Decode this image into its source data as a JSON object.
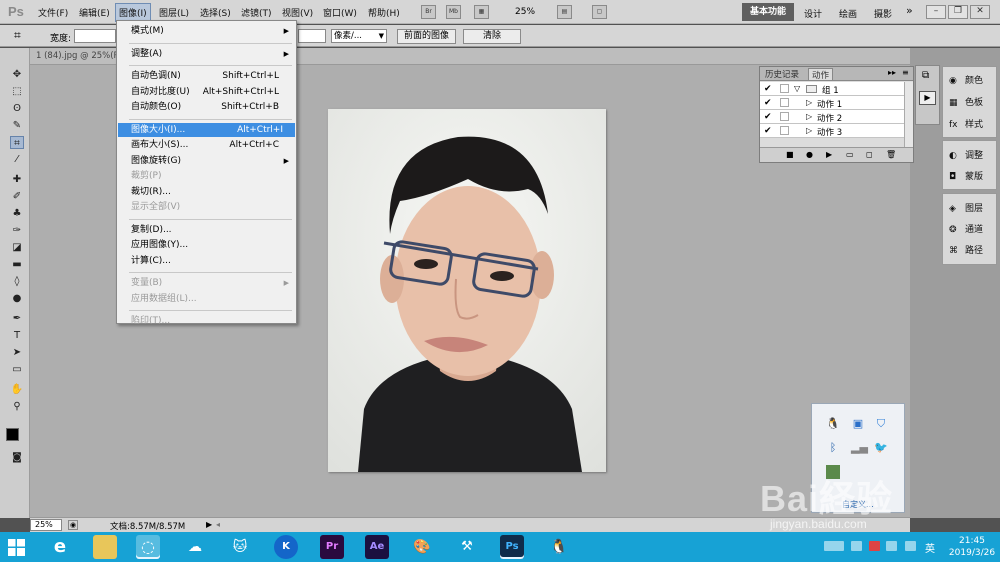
{
  "app": {
    "logo": "Ps",
    "accent": "#3d8ee2",
    "taskbar_color": "#17a2d5"
  },
  "menubar": {
    "items": [
      "文件(F)",
      "编辑(E)",
      "图像(I)",
      "图层(L)",
      "选择(S)",
      "滤镜(T)",
      "视图(V)",
      "窗口(W)",
      "帮助(H)"
    ],
    "active": "图像(I)",
    "bridge": "Br",
    "mini": "Mb",
    "zoom": "25%",
    "workspace_active": "基本功能",
    "workspaces": [
      "设计",
      "绘画",
      "摄影"
    ],
    "more": "»"
  },
  "options": {
    "width_label": "宽度:",
    "unit": "像素/...",
    "front_image": "前面的图像",
    "clear": "清除"
  },
  "document": {
    "tab_title": "1 (84).jpg @ 25%(RGB/8)"
  },
  "status": {
    "zoom": "25%",
    "doc": "文档:8.57M/8.57M"
  },
  "image_menu": [
    {
      "label": "模式(M)",
      "submenu": true
    },
    {
      "sep": true
    },
    {
      "label": "调整(A)",
      "submenu": true
    },
    {
      "sep": true
    },
    {
      "label": "自动色调(N)",
      "shortcut": "Shift+Ctrl+L"
    },
    {
      "label": "自动对比度(U)",
      "shortcut": "Alt+Shift+Ctrl+L"
    },
    {
      "label": "自动颜色(O)",
      "shortcut": "Shift+Ctrl+B"
    },
    {
      "sep": true
    },
    {
      "label": "图像大小(I)...",
      "shortcut": "Alt+Ctrl+I",
      "highlight": true
    },
    {
      "label": "画布大小(S)...",
      "shortcut": "Alt+Ctrl+C"
    },
    {
      "label": "图像旋转(G)",
      "submenu": true
    },
    {
      "label": "裁剪(P)",
      "disabled": true
    },
    {
      "label": "裁切(R)..."
    },
    {
      "label": "显示全部(V)",
      "disabled": true
    },
    {
      "sep": true
    },
    {
      "label": "复制(D)..."
    },
    {
      "label": "应用图像(Y)..."
    },
    {
      "label": "计算(C)..."
    },
    {
      "sep": true
    },
    {
      "label": "变量(B)",
      "submenu": true,
      "disabled": true
    },
    {
      "label": "应用数据组(L)...",
      "disabled": true
    },
    {
      "sep": true
    },
    {
      "label": "陷印(T)...",
      "disabled": true
    }
  ],
  "actions_panel": {
    "tabs": [
      "历史记录",
      "动作"
    ],
    "active_tab": "动作",
    "rows": [
      {
        "label": "组 1",
        "type": "set"
      },
      {
        "label": "动作 1",
        "type": "action"
      },
      {
        "label": "动作 2",
        "type": "action"
      },
      {
        "label": "动作 3",
        "type": "action"
      }
    ]
  },
  "side_panels": {
    "group1": [
      "颜色",
      "色板",
      "样式"
    ],
    "group2": [
      "调整",
      "蒙版"
    ],
    "group3": [
      "图层",
      "通道",
      "路径"
    ]
  },
  "tray_popup": {
    "link": "自定义..."
  },
  "taskbar": {
    "apps": [
      "edge-icon",
      "explorer-icon",
      "browser-icon",
      "baidu-netdisk-icon",
      "cat-icon",
      "k-icon",
      "premiere-icon",
      "after-effects-icon",
      "paint-icon",
      "tool-icon",
      "photoshop-icon",
      "qq-icon"
    ],
    "ime": "英",
    "time": "21:45",
    "date": "2019/3/26"
  },
  "watermark": {
    "brand": "Bai経验",
    "url": "jingyan.baidu.com"
  }
}
